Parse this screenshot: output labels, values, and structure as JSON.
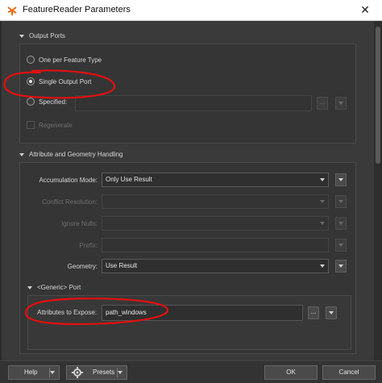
{
  "window": {
    "title": "FeatureReader Parameters",
    "close": "✕"
  },
  "output_ports": {
    "header": "Output Ports",
    "options": [
      {
        "label": "One per Feature Type",
        "selected": false
      },
      {
        "label": "Single Output Port",
        "selected": true
      },
      {
        "label": "Specified:",
        "selected": false
      }
    ],
    "specified_value": "",
    "browse_label": "...",
    "regenerate_label": "Regenerate"
  },
  "attr_geom": {
    "header": "Attribute and Geometry Handling",
    "accumulation_mode": {
      "label": "Accumulation Mode:",
      "value": "Only Use Result"
    },
    "conflict_resolution": {
      "label": "Conflict Resolution:",
      "value": ""
    },
    "ignore_nulls": {
      "label": "Ignore Nulls:",
      "value": ""
    },
    "prefix": {
      "label": "Prefix:",
      "value": ""
    },
    "geometry": {
      "label": "Geometry:",
      "value": "Use Result"
    }
  },
  "generic_port": {
    "header": "<Generic> Port",
    "attributes_to_expose": {
      "label": "Attributes to Expose:",
      "value": "path_windows"
    },
    "browse_label": "..."
  },
  "footer": {
    "help": "Help",
    "presets": "Presets",
    "ok": "OK",
    "cancel": "Cancel"
  },
  "colors": {
    "annotation_red": "#e01010",
    "background": "#3a3a3a"
  }
}
